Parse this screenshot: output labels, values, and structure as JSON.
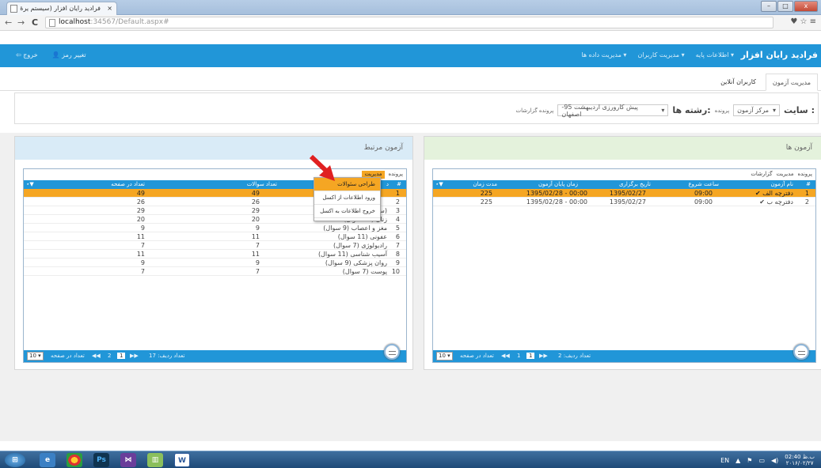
{
  "browser": {
    "tab_title": "فرادید رایان افزار (سیستم یرهٔ",
    "tab_close": "×",
    "url_host": "localhost",
    "url_rest": ":34567/Default.aspx#",
    "win_min": "–",
    "win_max": "□",
    "win_close": "x",
    "nav_back": "←",
    "nav_fwd": "→",
    "nav_reload": "C",
    "tools": "♥ ☆ ≡"
  },
  "app": {
    "brand": "فرادید رایان افزار",
    "nav": [
      "اطلاعات پایه ▾",
      "مدیریت کاربران ▾",
      "مدیریت داده ها ▾"
    ],
    "user": "تغییر رمز",
    "logout": "خروج",
    "tabs": {
      "active": "مدیریت آزمون",
      "other": "کاربران آنلاین"
    }
  },
  "filter": {
    "site_label": "سایت :",
    "site_value": "مرکز آزمون",
    "small_label": "پرونده",
    "field_label": "رشته ها:",
    "field_value": "پیش کارورزی اردیبهشت 95-اصفهان",
    "report_label": "پرونده  گزارشات",
    "caret": "▾"
  },
  "exams_panel": {
    "title": "آزمون ها",
    "menu": [
      "پرونده",
      "مدیریت",
      "گزارشات"
    ],
    "columns": [
      "#",
      "نام آزمون",
      "ساعت شروع",
      "تاریخ برگزاری",
      "زمان پایان آزمون",
      "مدت زمان"
    ],
    "rows": [
      {
        "n": "1",
        "name": "✔ دفترچه الف",
        "start": "09:00",
        "date": "1395/02/27",
        "end": "1395/02/28 - 00:00",
        "dur": "225"
      },
      {
        "n": "2",
        "name": "✔ دفترچه ب",
        "start": "09:00",
        "date": "1395/02/27",
        "end": "1395/02/28 - 00:00",
        "dur": "225"
      }
    ],
    "footer_rows": "تعداد ردیف: 2",
    "footer_page": "1",
    "footer_pages": "1",
    "footer_per_page": "تعداد در صفحه",
    "per_page_value": "10 ▾"
  },
  "related_panel": {
    "title": "آزمون مرتبط",
    "menu": [
      "پرونده",
      "مدیریت"
    ],
    "columns": [
      "#",
      "د",
      "تعداد سوالات",
      "تعداد در صفحه"
    ],
    "rows": [
      {
        "n": "1",
        "name": "",
        "q": "49",
        "p": "49"
      },
      {
        "n": "2",
        "name": "",
        "q": "26",
        "p": "26"
      },
      {
        "n": "3",
        "name": "(سوال 29)",
        "q": "29",
        "p": "29"
      },
      {
        "n": "4",
        "name": "زنان (20 سوال)",
        "q": "20",
        "p": "20"
      },
      {
        "n": "5",
        "name": "مغز و اعصاب (9 سوال)",
        "q": "9",
        "p": "9"
      },
      {
        "n": "6",
        "name": "عفونی (11 سوال)",
        "q": "11",
        "p": "11"
      },
      {
        "n": "7",
        "name": "رادیولوژی (7 سوال)",
        "q": "7",
        "p": "7"
      },
      {
        "n": "8",
        "name": "آسیب شناسی (11 سوال)",
        "q": "11",
        "p": "11"
      },
      {
        "n": "9",
        "name": "روان پزشکی (9 سوال)",
        "q": "9",
        "p": "9"
      },
      {
        "n": "10",
        "name": "پوست (7 سوال)",
        "q": "7",
        "p": "7"
      }
    ],
    "footer_rows": "تعداد ردیف: 17",
    "footer_page": "1",
    "footer_pages": "2",
    "footer_per_page": "تعداد در صفحه",
    "per_page_value": "10 ▾"
  },
  "context_menu": [
    "طراحی سئوالات",
    "ورود اطلاعات از اکسل",
    "خروج اطلاعات به اکسل"
  ],
  "taskbar": {
    "lang": "EN",
    "time": "02:40 ب.ظ",
    "date": "۲۰۱۶/۰۲/۲۷"
  },
  "colors": {
    "primary": "#2196d8",
    "highlight": "#f5a623",
    "arrow": "#e02020"
  }
}
